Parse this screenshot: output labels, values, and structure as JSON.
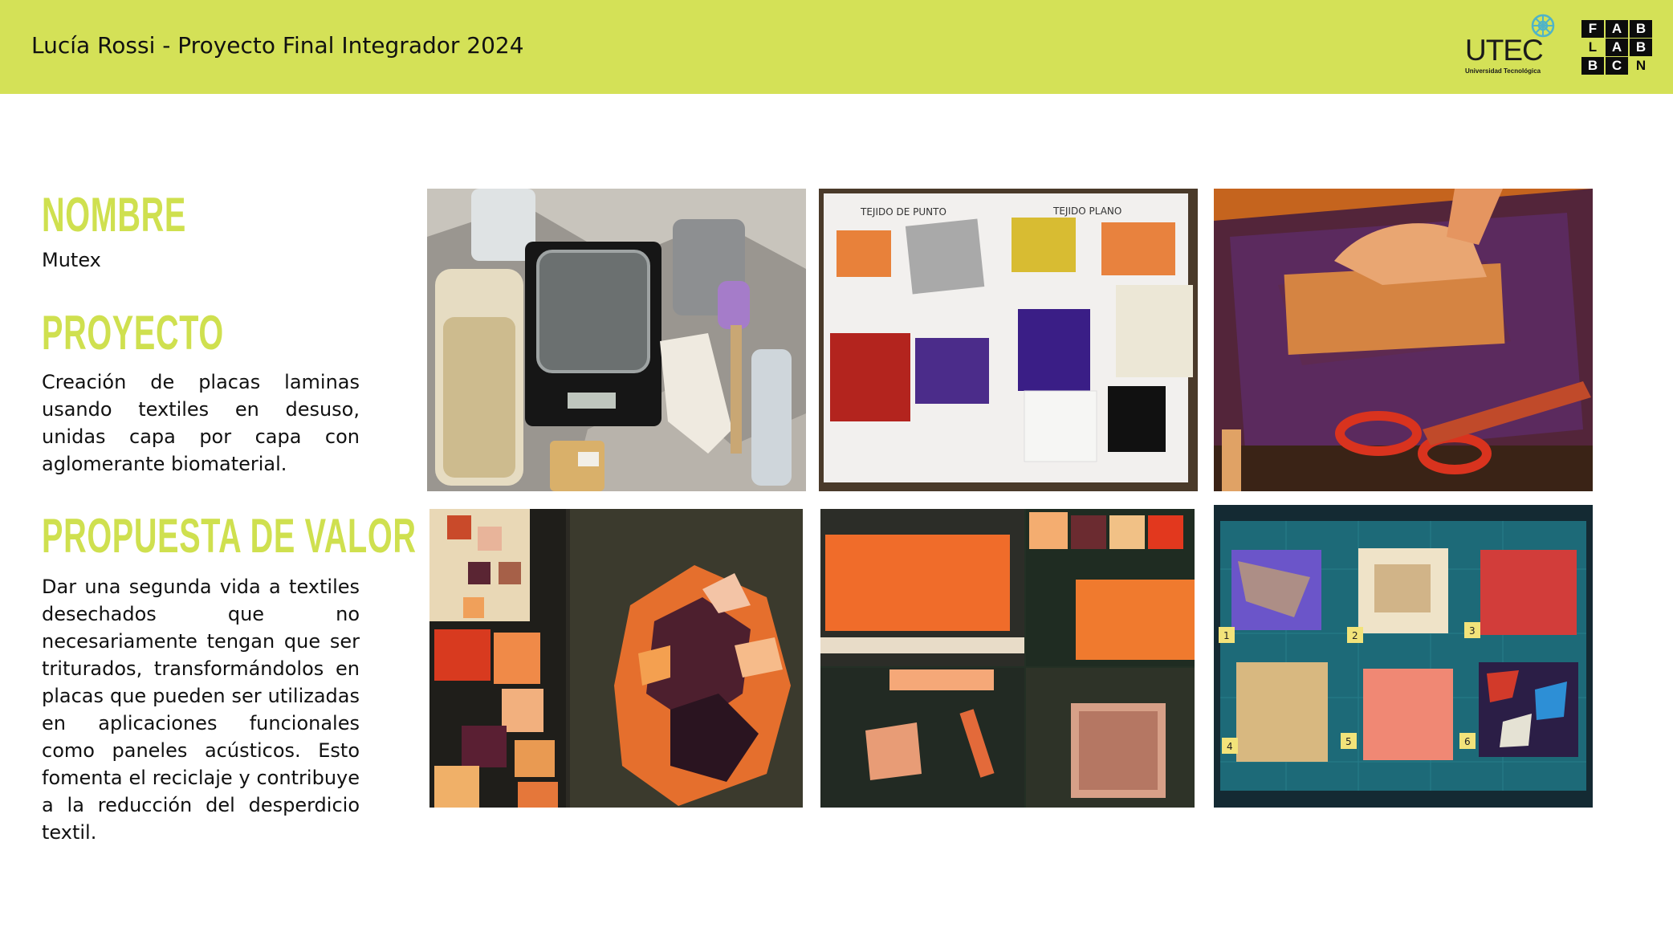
{
  "header": {
    "title": "Lucía Rossi - Proyecto Final Integrador 2024",
    "bg_color": "#d4e157",
    "logos": {
      "utec": {
        "name": "UTEC",
        "subtitle": "Universidad Tecnológica"
      },
      "fablab": {
        "cells": [
          "F",
          "A",
          "B",
          "L",
          "A",
          "B",
          "B",
          "C",
          "N"
        ]
      }
    }
  },
  "sections": {
    "nombre": {
      "heading": "NOMBRE",
      "text": "Mutex"
    },
    "proyecto": {
      "heading": "PROYECTO",
      "text": "Creación de placas laminas usando textiles en desuso, unidas capa por capa con aglomerante biomaterial."
    },
    "propuesta": {
      "heading": "PROPUESTA DE VALOR",
      "text": "Dar una segunda vida a textiles desechados que no necesariamente tengan que ser triturados, transformándolos en placas que pueden ser utilizadas en aplicaciones funcionales como paneles acústicos. Esto fomenta el reciclaje y contribuye a la reducción del desperdicio textil."
    }
  },
  "accent_color": "#cfe04f",
  "photos": {
    "sample_board": {
      "labels": [
        "TEJIDO DE PUNTO",
        "TEJIDO PLANO"
      ]
    },
    "numbered_samples": {
      "numbers": [
        "1",
        "2",
        "3",
        "4",
        "5",
        "6"
      ]
    }
  }
}
